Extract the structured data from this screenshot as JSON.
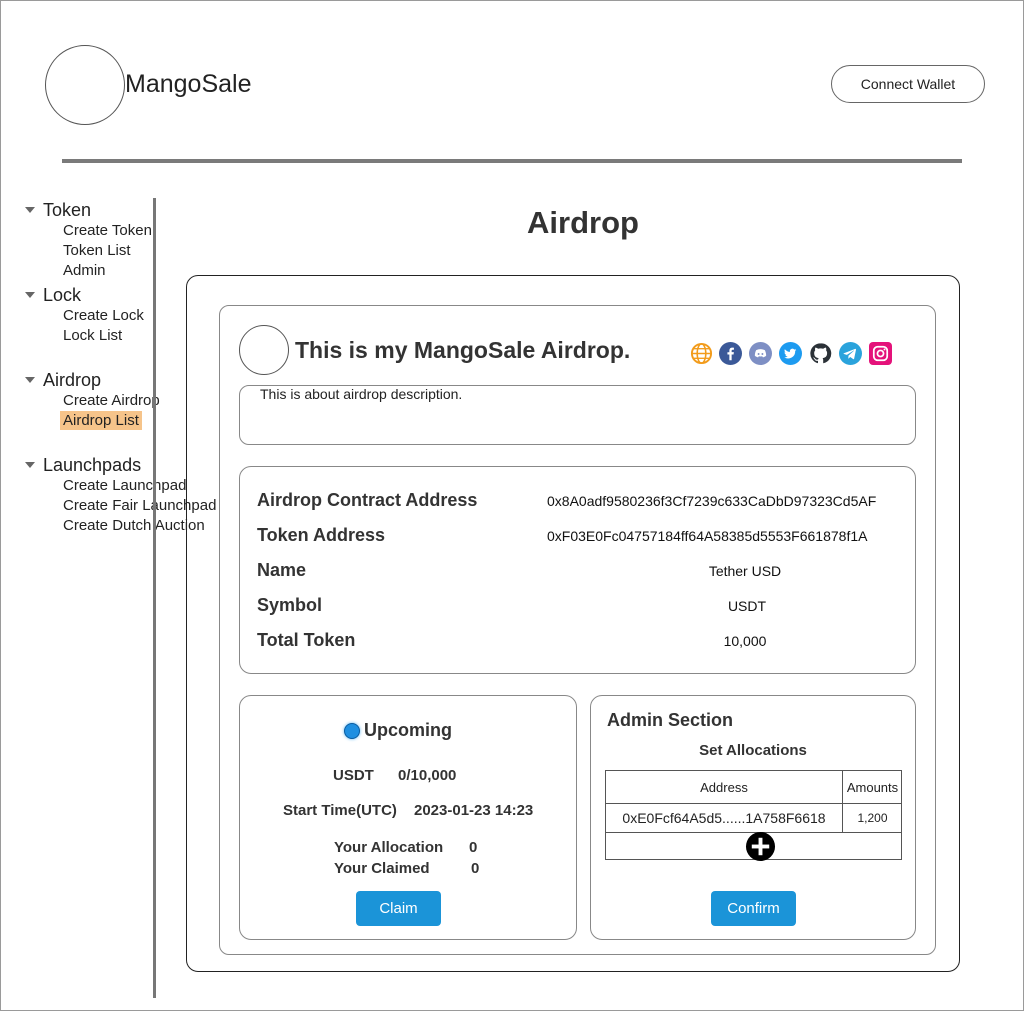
{
  "app": {
    "name": "MangoSale",
    "connect_label": "Connect Wallet"
  },
  "sidebar": {
    "groups": [
      {
        "label": "Token",
        "items": [
          "Create Token",
          "Token List",
          "Admin"
        ]
      },
      {
        "label": "Lock",
        "items": [
          "Create Lock",
          "Lock List"
        ]
      },
      {
        "label": "Airdrop",
        "items": [
          "Create Airdrop",
          "Airdrop List"
        ],
        "active": "Airdrop List"
      },
      {
        "label": "Launchpads",
        "items": [
          "Create Launchpad",
          "Create Fair Launchpad",
          "Create Dutch Auction"
        ]
      }
    ]
  },
  "page": {
    "title": "Airdrop"
  },
  "airdrop": {
    "title": "This is my MangoSale Airdrop.",
    "description": "This is about airdrop description.",
    "social_icons": [
      "globe-icon",
      "facebook-icon",
      "discord-icon",
      "twitter-icon",
      "github-icon",
      "telegram-icon",
      "instagram-icon"
    ],
    "details": [
      {
        "label": "Airdrop Contract Address",
        "value": "0x8A0adf9580236f3Cf7239c633CaDbD97323Cd5AF"
      },
      {
        "label": "Token Address",
        "value": "0xF03E0Fc04757184ff64A58385d5553F661878f1A"
      },
      {
        "label": "Name",
        "value": "Tether USD"
      },
      {
        "label": "Symbol",
        "value": "USDT"
      },
      {
        "label": "Total Token",
        "value": "10,000"
      }
    ]
  },
  "status": {
    "state": "Upcoming",
    "token_symbol": "USDT",
    "progress": "0/10,000",
    "start_label": "Start Time(UTC)",
    "start_value": "2023-01-23 14:23",
    "allocation_label": "Your Allocation",
    "allocation_value": "0",
    "claimed_label": "Your Claimed",
    "claimed_value": "0",
    "claim_button": "Claim"
  },
  "admin": {
    "title": "Admin Section",
    "subtitle": "Set Allocations",
    "columns": [
      "Address",
      "Amounts"
    ],
    "rows": [
      {
        "address": "0xE0Fcf64A5d5......1A758F6618",
        "amount": "1,200"
      }
    ],
    "confirm_button": "Confirm"
  },
  "colors": {
    "accent": "#1b94d8",
    "active_nav": "#f6c48a",
    "status_dot": "#1e8fe1"
  }
}
